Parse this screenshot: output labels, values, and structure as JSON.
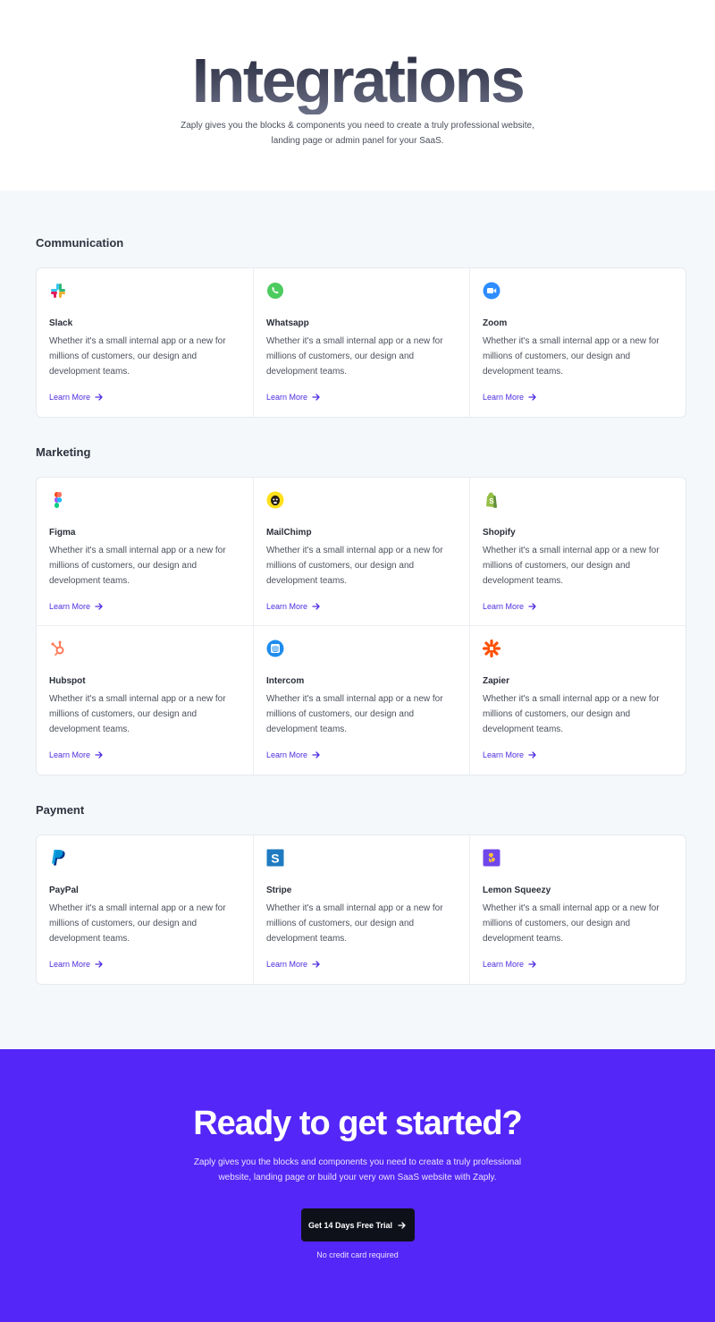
{
  "hero": {
    "title": "Integrations",
    "subtitle": "Zaply gives you the blocks & components you need to create a truly professional website, landing page or admin panel for your SaaS."
  },
  "colors": {
    "accent": "#5426f7",
    "link": "#4f2de0",
    "background": "#f5f8fa",
    "button": "#0f111a"
  },
  "categories": [
    {
      "title": "Communication",
      "items": [
        {
          "name": "Slack",
          "icon": "slack-icon",
          "description": "Whether it's a small internal app or a new for millions of customers, our design and development teams.",
          "link": "Learn More"
        },
        {
          "name": "Whatsapp",
          "icon": "whatsapp-icon",
          "description": "Whether it's a small internal app or a new for millions of customers, our design and development teams.",
          "link": "Learn More"
        },
        {
          "name": "Zoom",
          "icon": "zoom-icon",
          "description": "Whether it's a small internal app or a new for millions of customers, our design and development teams.",
          "link": "Learn More"
        }
      ]
    },
    {
      "title": "Marketing",
      "items": [
        {
          "name": "Figma",
          "icon": "figma-icon",
          "description": "Whether it's a small internal app or a new for millions of customers, our design and development teams.",
          "link": "Learn More"
        },
        {
          "name": "MailChimp",
          "icon": "mailchimp-icon",
          "description": "Whether it's a small internal app or a new for millions of customers, our design and development teams.",
          "link": "Learn More"
        },
        {
          "name": "Shopify",
          "icon": "shopify-icon",
          "description": "Whether it's a small internal app or a new for millions of customers, our design and development teams.",
          "link": "Learn More"
        },
        {
          "name": "Hubspot",
          "icon": "hubspot-icon",
          "description": "Whether it's a small internal app or a new for millions of customers, our design and development teams.",
          "link": "Learn More"
        },
        {
          "name": "Intercom",
          "icon": "intercom-icon",
          "description": "Whether it's a small internal app or a new for millions of customers, our design and development teams.",
          "link": "Learn More"
        },
        {
          "name": "Zapier",
          "icon": "zapier-icon",
          "description": "Whether it's a small internal app or a new for millions of customers, our design and development teams.",
          "link": "Learn More"
        }
      ]
    },
    {
      "title": "Payment",
      "items": [
        {
          "name": "PayPal",
          "icon": "paypal-icon",
          "description": "Whether it's a small internal app or a new for millions of customers, our design and development teams.",
          "link": "Learn More"
        },
        {
          "name": "Stripe",
          "icon": "stripe-icon",
          "description": "Whether it's a small internal app or a new for millions of customers, our design and development teams.",
          "link": "Learn More"
        },
        {
          "name": "Lemon Squeezy",
          "icon": "lemon-squeezy-icon",
          "description": "Whether it's a small internal app or a new for millions of customers, our design and development teams.",
          "link": "Learn More"
        }
      ]
    }
  ],
  "cta": {
    "title": "Ready to get started?",
    "subtitle": "Zaply gives you the blocks and components you need to create a truly professional website, landing page or build your very own SaaS website with Zaply.",
    "button_label": "Get 14 Days Free Trial",
    "note": "No credit card required"
  }
}
